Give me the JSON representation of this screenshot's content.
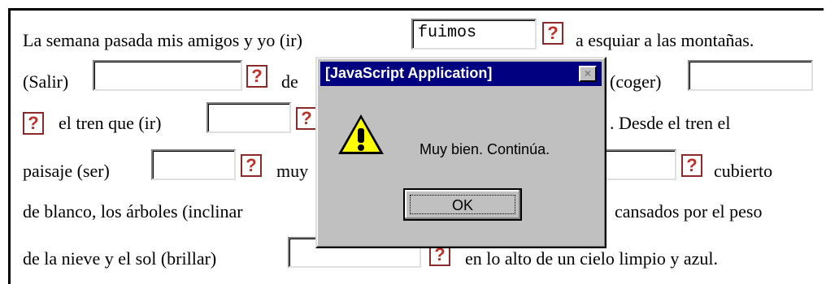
{
  "exercise": {
    "line1": {
      "t1": "La semana pasada mis amigos y yo (ir)",
      "field1": "fuimos",
      "t2": "a esquiar a las montañas."
    },
    "line2": {
      "t1": "(Salir)",
      "t2": "de",
      "t3": "(coger)"
    },
    "line3": {
      "t1": "el tren que (ir)",
      "t2": ". Desde el tren el"
    },
    "line4": {
      "t1": "paisaje (ser)",
      "t2": "muy",
      "t3": "cubierto"
    },
    "line5": {
      "t1": "de blanco, los árboles (inclinar",
      "t2": "cansados por el peso"
    },
    "line6": {
      "t1": "de la nieve y el sol (brillar)",
      "t2": "en lo alto de un cielo limpio y azul."
    },
    "help_label": "?"
  },
  "dialog": {
    "title": "[JavaScript Application]",
    "close_label": "×",
    "message": "Muy bien. Continúa.",
    "ok_label": "OK",
    "icon": "warning-icon"
  }
}
